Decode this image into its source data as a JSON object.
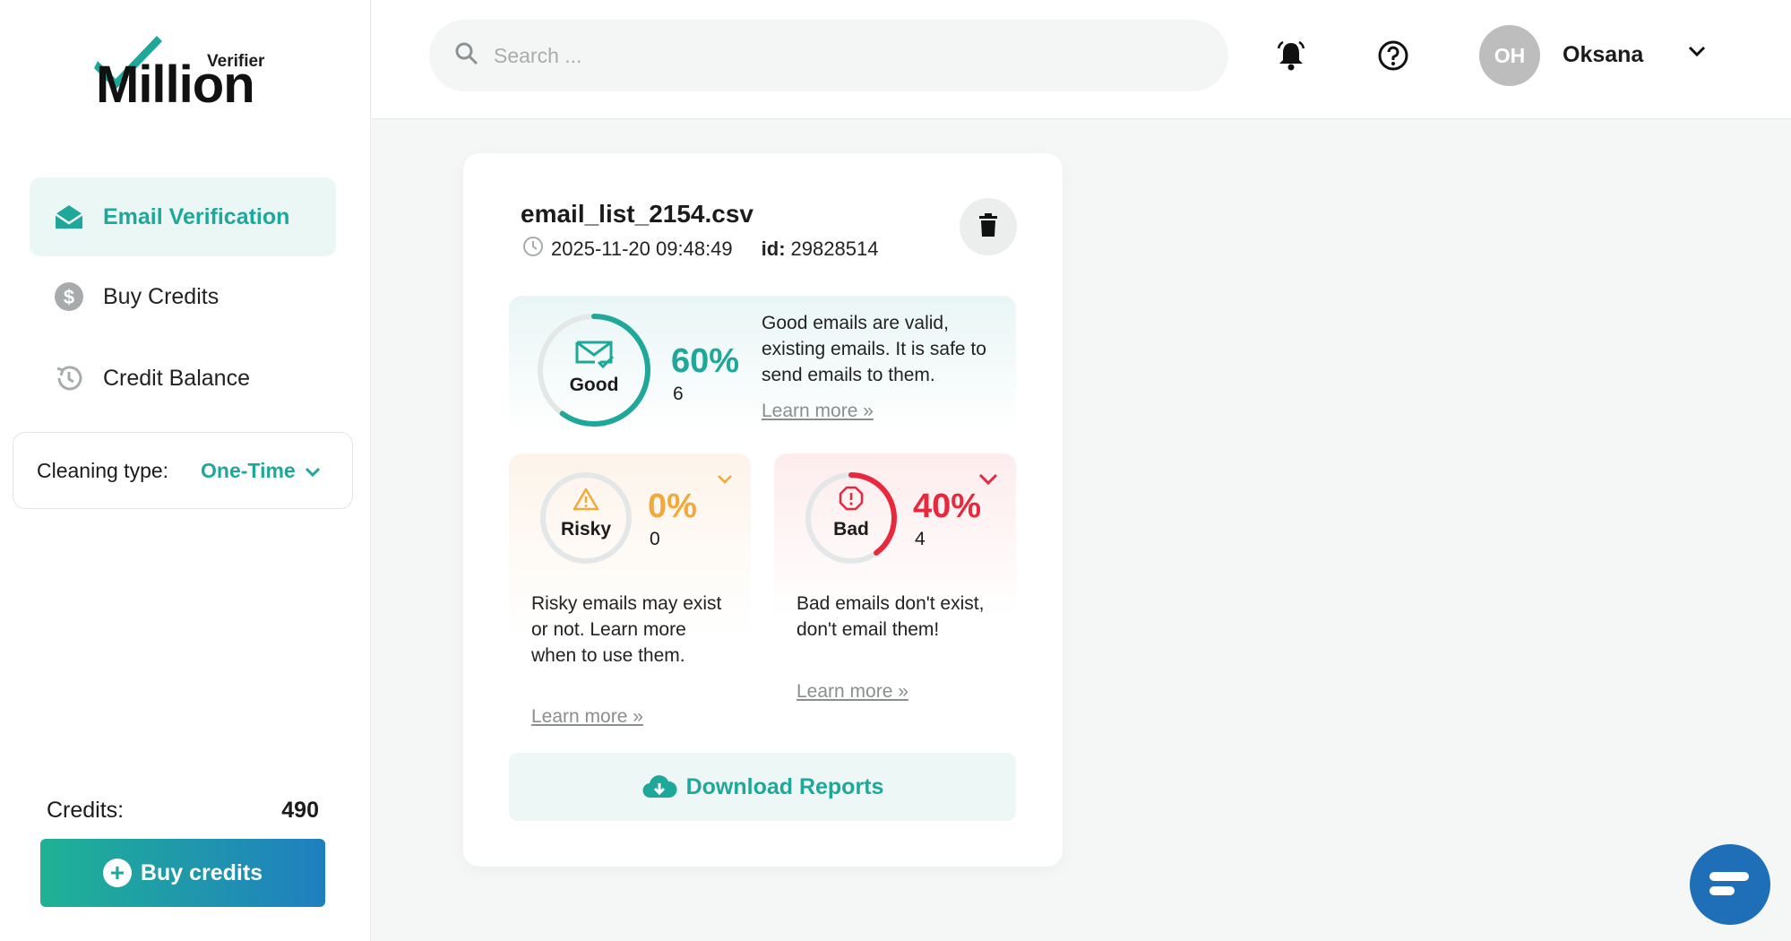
{
  "logo": {
    "top_word": "Verifier",
    "main_word": "Million"
  },
  "sidebar": {
    "items": [
      {
        "label": "Email Verification",
        "icon": "open-envelope-icon",
        "active": true
      },
      {
        "label": "Buy Credits",
        "icon": "dollar-coin-icon",
        "active": false
      },
      {
        "label": "Credit Balance",
        "icon": "history-clock-icon",
        "active": false
      }
    ],
    "cleaning": {
      "label": "Cleaning type:",
      "value": "One-Time"
    },
    "credits": {
      "label": "Credits:",
      "value": "490"
    },
    "buy_button": "Buy credits"
  },
  "header": {
    "search_placeholder": "Search ...",
    "user": {
      "initials": "OH",
      "name": "Oksana"
    }
  },
  "card": {
    "file_name": "email_list_2154.csv",
    "timestamp": "2025-11-20 09:48:49",
    "id_label": "id:",
    "id_value": "29828514",
    "good": {
      "label": "Good",
      "percent": "60%",
      "count": "6",
      "fraction": 0.6,
      "description": "Good emails are valid, existing emails. It is safe to send emails to them.",
      "learn_more": "Learn more »"
    },
    "risky": {
      "label": "Risky",
      "percent": "0%",
      "count": "0",
      "fraction": 0.0,
      "description": "Risky emails may exist or not. Learn more when to use them.",
      "learn_more": "Learn more »"
    },
    "bad": {
      "label": "Bad",
      "percent": "40%",
      "count": "4",
      "fraction": 0.4,
      "description": "Bad emails don't exist, don't email them!",
      "learn_more": "Learn more »"
    },
    "download_label": "Download Reports"
  },
  "colors": {
    "accent": "#1fa89a",
    "risky": "#f2a93b",
    "bad": "#e8293d",
    "buy_gradient_start": "#1fb295",
    "buy_gradient_end": "#1f7fc0"
  }
}
